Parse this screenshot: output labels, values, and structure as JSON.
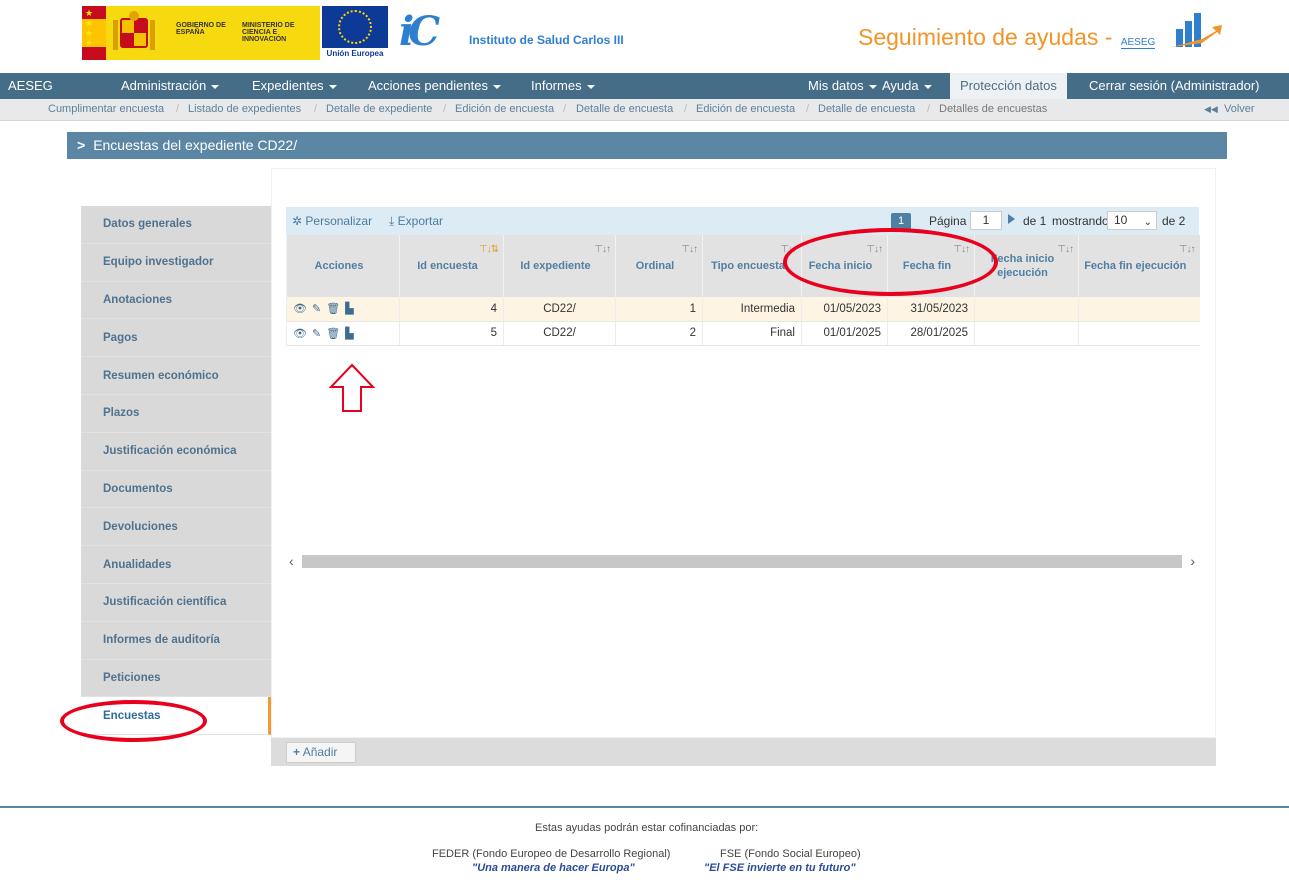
{
  "header": {
    "gov_text_1": "Gobierno de España",
    "gov_text_2": "Ministerio de Ciencia e Innovación",
    "eu_text": "Unión Europea",
    "institute_name": "Instituto de Salud Carlos III",
    "app_title": "Seguimiento de ayudas -",
    "app_sub": "AESEG"
  },
  "nav": {
    "items": [
      {
        "label": "AESEG"
      },
      {
        "label": "Administración"
      },
      {
        "label": "Expedientes"
      },
      {
        "label": "Acciones pendientes"
      },
      {
        "label": "Informes"
      },
      {
        "label": "Mis datos"
      },
      {
        "label": "Ayuda"
      },
      {
        "label": "Protección datos"
      },
      {
        "label": "Cerrar sesión (Administrador)"
      }
    ]
  },
  "breadcrumb": {
    "items": [
      "Cumplimentar encuesta",
      "Listado de expedientes",
      "Detalle de expediente",
      "Edición de encuesta",
      "Detalle de encuesta",
      "Edición de encuesta",
      "Detalle de encuesta",
      "Detalles de encuestas"
    ],
    "back": "Volver"
  },
  "panel": {
    "title": "Encuestas del expediente CD22/"
  },
  "sidemenu": {
    "items": [
      "Datos generales",
      "Equipo investigador",
      "Anotaciones",
      "Pagos",
      "Resumen económico",
      "Plazos",
      "Justificación económica",
      "Documentos",
      "Devoluciones",
      "Anualidades",
      "Justificación científica",
      "Informes de auditoría",
      "Peticiones",
      "Encuestas"
    ]
  },
  "toolbar": {
    "customize": "Personalizar",
    "export": "Exportar",
    "page_badge": "1",
    "page_label": "Página",
    "page_value": "1",
    "of_pages": "de 1",
    "showing": "mostrando",
    "page_size": "10",
    "of_total": "de 2"
  },
  "grid": {
    "columns": [
      "Acciones",
      "Id encuesta",
      "Id expediente",
      "Ordinal",
      "Tipo encuesta",
      "Fecha inicio",
      "Fecha fin",
      "Fecha inicio ejecución",
      "Fecha fin ejecución"
    ],
    "rows": [
      {
        "id": "4",
        "expediente": "CD22/",
        "ordinal": "1",
        "tipo": "Intermedia",
        "inicio": "01/05/2023",
        "fin": "31/05/2023",
        "inicio_ej": "",
        "fin_ej": ""
      },
      {
        "id": "5",
        "expediente": "CD22/",
        "ordinal": "2",
        "tipo": "Final",
        "inicio": "01/01/2025",
        "fin": "28/01/2025",
        "inicio_ej": "",
        "fin_ej": ""
      }
    ]
  },
  "add_button": "Añadir",
  "footer": {
    "cofinance": "Estas ayudas podrán estar cofinanciadas por:",
    "feder": "FEDER (Fondo Europeo de Desarrollo Regional)",
    "feder_quote": "\"Una manera de hacer Europa\"",
    "fse": "FSE (Fondo Social Europeo)",
    "fse_quote": "\"El FSE invierte en tu futuro\""
  },
  "colors": {
    "nav": "#466d88",
    "accent": "#f29a2e",
    "annotation": "#e8001c"
  }
}
